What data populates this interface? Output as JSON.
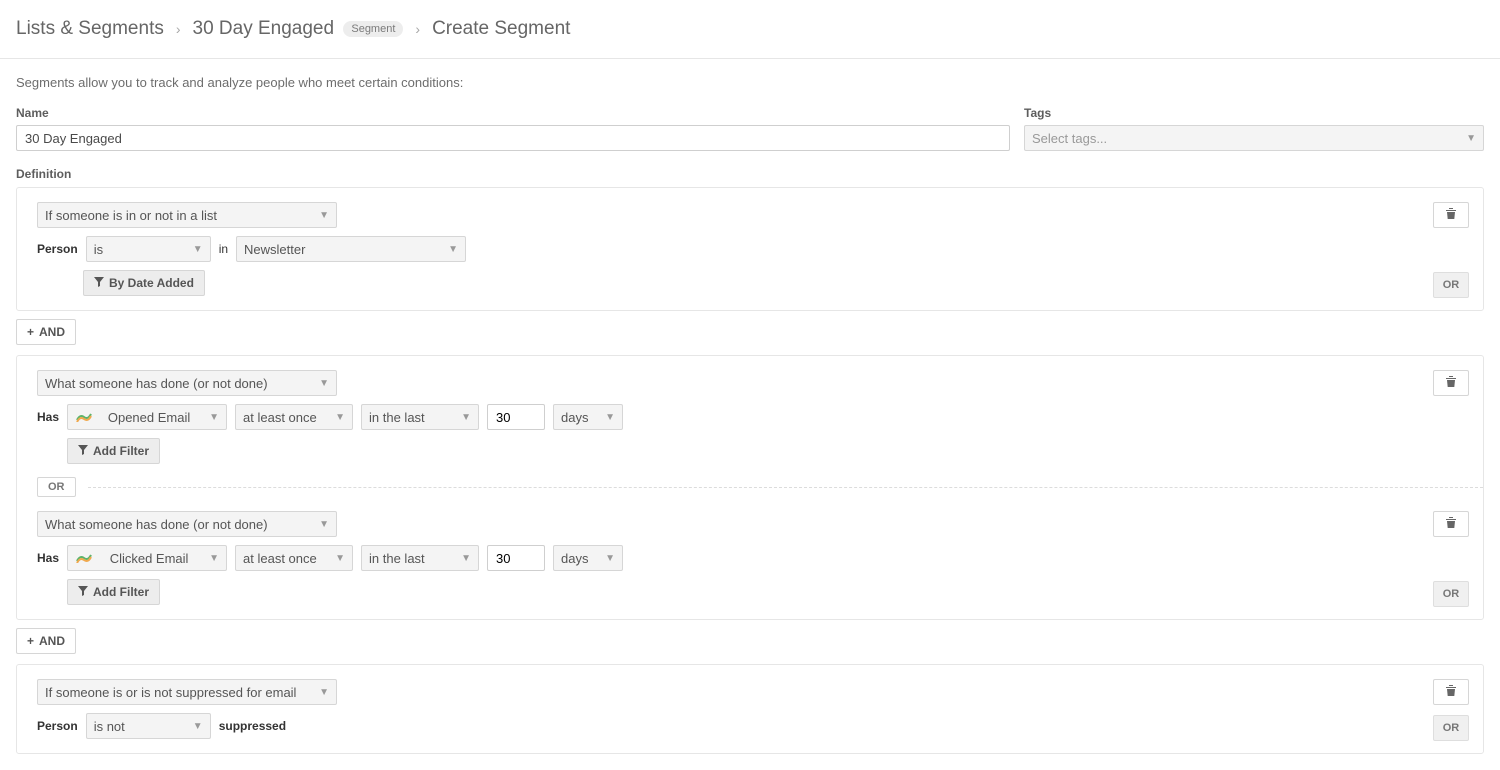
{
  "breadcrumb": {
    "root": "Lists & Segments",
    "item": "30 Day Engaged",
    "badge": "Segment",
    "current": "Create Segment"
  },
  "intro": "Segments allow you to track and analyze people who meet certain conditions:",
  "labels": {
    "name": "Name",
    "tags": "Tags",
    "definition": "Definition"
  },
  "form": {
    "name_value": "30 Day Engaged",
    "tags_placeholder": "Select tags..."
  },
  "buttons": {
    "and": "AND",
    "or": "OR",
    "add_filter": "Add Filter",
    "by_date_added": "By Date Added"
  },
  "conditions": [
    {
      "type_select": "If someone is in or not in a list",
      "person_label": "Person",
      "is_select": "is",
      "in_label": "in",
      "list_select": "Newsletter"
    },
    {
      "groups": [
        {
          "type_select": "What someone has done (or not done)",
          "has_label": "Has",
          "event_select": "Opened Email",
          "freq_select": "at least once",
          "timeframe_select": "in the last",
          "count_value": "30",
          "unit_select": "days"
        },
        {
          "type_select": "What someone has done (or not done)",
          "has_label": "Has",
          "event_select": "Clicked Email",
          "freq_select": "at least once",
          "timeframe_select": "in the last",
          "count_value": "30",
          "unit_select": "days"
        }
      ]
    },
    {
      "type_select": "If someone is or is not suppressed for email",
      "person_label": "Person",
      "is_select": "is not",
      "suppressed_label": "suppressed"
    }
  ]
}
